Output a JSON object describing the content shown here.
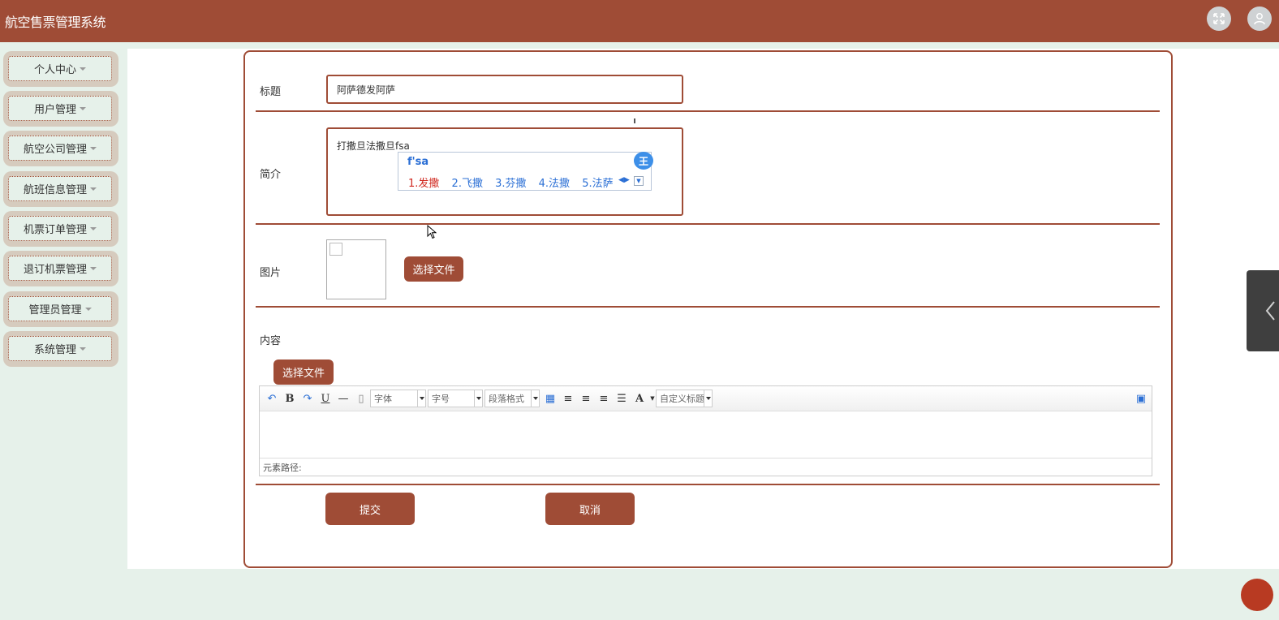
{
  "app": {
    "title": "航空售票管理系统",
    "accent_color": "#9f4c36"
  },
  "header": {
    "fullscreen_icon": "expand-icon",
    "user_icon": "user-icon"
  },
  "sidebar": {
    "items": [
      {
        "label": "个人中心"
      },
      {
        "label": "用户管理"
      },
      {
        "label": "航空公司管理"
      },
      {
        "label": "航班信息管理"
      },
      {
        "label": "机票订单管理"
      },
      {
        "label": "退订机票管理"
      },
      {
        "label": "管理员管理"
      },
      {
        "label": "系统管理"
      }
    ]
  },
  "form": {
    "title_label": "标题",
    "title_value": "阿萨德发阿萨",
    "intro_label": "简介",
    "intro_value": "打撒旦法撒旦fsa",
    "image_label": "图片",
    "image_choose_label": "选择文件",
    "content_label": "内容",
    "content_choose_label": "选择文件",
    "submit_label": "提交",
    "cancel_label": "取消"
  },
  "ime": {
    "composition": "f'sa",
    "candidates": [
      "1.发撒",
      "2.飞撒",
      "3.芬撒",
      "4.法撒",
      "5.法萨"
    ],
    "logo": "王"
  },
  "editor": {
    "font_select": "字体",
    "size_select": "字号",
    "paragraph_select": "段落格式",
    "custom_title_select": "自定义标题",
    "bold_label": "B",
    "underline_label": "U",
    "fontcolor_label": "A",
    "status_path": "元素路径:"
  }
}
